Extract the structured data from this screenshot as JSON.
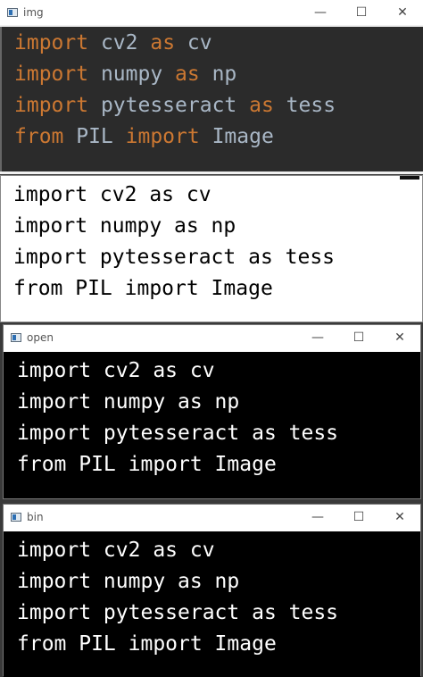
{
  "windows": [
    {
      "title": "img",
      "controls": {
        "minimize": "—",
        "maximize": "☐",
        "close": "✕"
      },
      "lines": [
        [
          {
            "t": "import",
            "kw": true
          },
          {
            "t": " cv2 "
          },
          {
            "t": "as",
            "kw": true
          },
          {
            "t": " cv"
          }
        ],
        [
          {
            "t": "import",
            "kw": true
          },
          {
            "t": " numpy "
          },
          {
            "t": "as",
            "kw": true
          },
          {
            "t": " np"
          }
        ],
        [
          {
            "t": "import",
            "kw": true
          },
          {
            "t": " pytesseract "
          },
          {
            "t": "as",
            "kw": true
          },
          {
            "t": " tess"
          }
        ],
        [
          {
            "t": "from",
            "kw": true
          },
          {
            "t": " PIL "
          },
          {
            "t": "import",
            "kw": true
          },
          {
            "t": " Image"
          }
        ]
      ]
    },
    {
      "lines": [
        "import cv2 as cv",
        "import numpy as np",
        "import pytesseract as tess",
        "from PIL import Image"
      ]
    },
    {
      "title": "open",
      "controls": {
        "minimize": "—",
        "maximize": "☐",
        "close": "✕"
      },
      "lines": [
        "import cv2 as cv",
        "import numpy as np",
        "import pytesseract as tess",
        "from PIL import Image"
      ]
    },
    {
      "title": "bin",
      "controls": {
        "minimize": "—",
        "maximize": "☐",
        "close": "✕"
      },
      "lines": [
        "import cv2 as cv",
        "import numpy as np",
        "import pytesseract as tess",
        "from PIL import Image"
      ]
    }
  ],
  "colors": {
    "keyword": "#cc7832",
    "identifier": "#a9b7c6",
    "editor_bg": "#2b2b2b",
    "binary_bg": "#000000"
  }
}
